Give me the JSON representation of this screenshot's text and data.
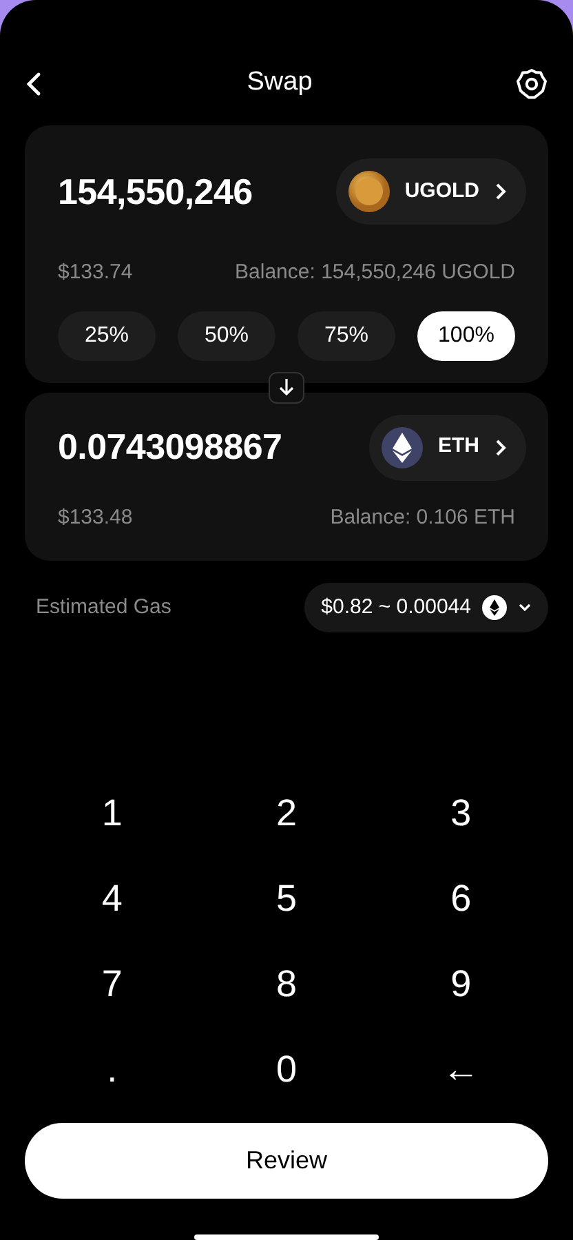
{
  "header": {
    "title": "Swap"
  },
  "from": {
    "amount": "154,550,246",
    "token": "UGOLD",
    "fiat": "$133.74",
    "balance": "Balance: 154,550,246 UGOLD"
  },
  "percent_buttons": [
    {
      "label": "25%",
      "selected": false
    },
    {
      "label": "50%",
      "selected": false
    },
    {
      "label": "75%",
      "selected": false
    },
    {
      "label": "100%",
      "selected": true
    }
  ],
  "to": {
    "amount": "0.0743098867",
    "token": "ETH",
    "fiat": "$133.48",
    "balance": "Balance: 0.106 ETH"
  },
  "gas": {
    "label": "Estimated Gas",
    "value": "$0.82 ~ 0.00044"
  },
  "keypad": [
    {
      "kind": "key",
      "label": "1"
    },
    {
      "kind": "key",
      "label": "2"
    },
    {
      "kind": "key",
      "label": "3"
    },
    {
      "kind": "key",
      "label": "4"
    },
    {
      "kind": "key",
      "label": "5"
    },
    {
      "kind": "key",
      "label": "6"
    },
    {
      "kind": "key",
      "label": "7"
    },
    {
      "kind": "key",
      "label": "8"
    },
    {
      "kind": "key",
      "label": "9"
    },
    {
      "kind": "key",
      "label": "."
    },
    {
      "kind": "key",
      "label": "0"
    },
    {
      "kind": "key",
      "label": "←"
    }
  ],
  "review_button": "Review"
}
